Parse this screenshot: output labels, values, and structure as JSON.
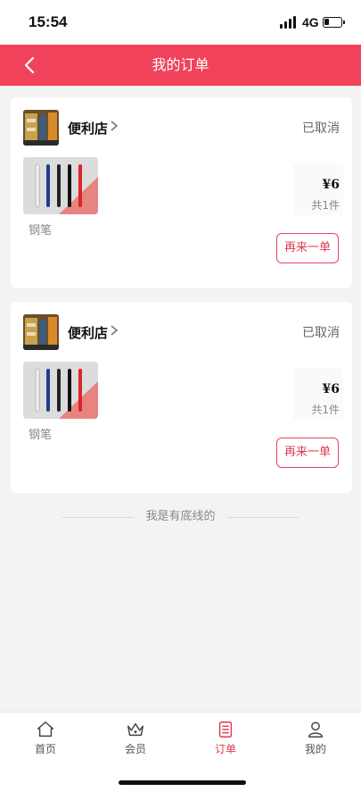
{
  "status_bar": {
    "time": "15:54",
    "network": "4G"
  },
  "nav": {
    "title": "我的订单"
  },
  "orders": [
    {
      "shop_name": "便利店",
      "status": "已取消",
      "product_name": "钢笔",
      "price": "¥6",
      "quantity": "共1件",
      "reorder_label": "再来一单"
    },
    {
      "shop_name": "便利店",
      "status": "已取消",
      "product_name": "钢笔",
      "price": "¥6",
      "quantity": "共1件",
      "reorder_label": "再来一单"
    }
  ],
  "end_text": "我是有底线的",
  "tabs": [
    {
      "label": "首页",
      "icon": "home-icon",
      "active": false
    },
    {
      "label": "会员",
      "icon": "crown-icon",
      "active": false
    },
    {
      "label": "订单",
      "icon": "order-list-icon",
      "active": true
    },
    {
      "label": "我的",
      "icon": "user-icon",
      "active": false
    }
  ],
  "colors": {
    "accent": "#f0435b",
    "active_tab": "#e03a50"
  }
}
